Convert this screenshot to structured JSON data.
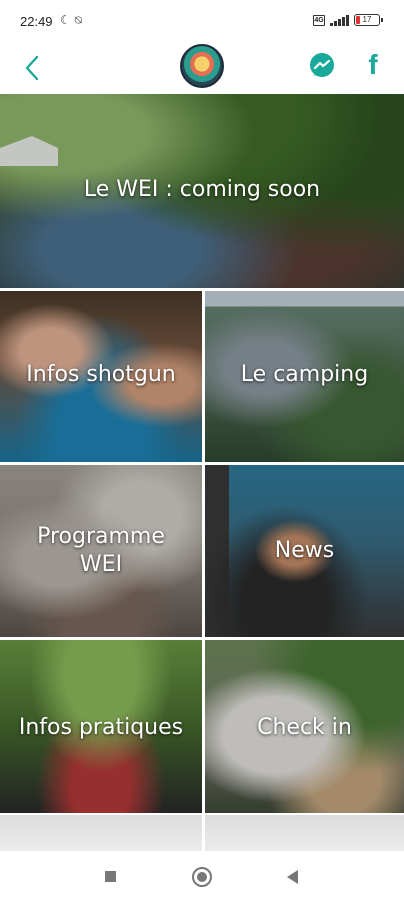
{
  "status_bar": {
    "time": "22:49",
    "left_icons": [
      "moon-icon",
      "mute-icon"
    ],
    "sim_label": "4G",
    "battery_level": "17"
  },
  "header": {
    "back_icon": "chevron-left-icon",
    "logo": "wei-logo",
    "messenger_icon": "messenger-icon",
    "facebook_icon": "facebook-icon",
    "facebook_glyph": "f",
    "accent_color": "#19a99a"
  },
  "hero": {
    "title": "Le WEI : coming soon"
  },
  "tiles": [
    {
      "label": "Infos shotgun"
    },
    {
      "label": "Le camping"
    },
    {
      "label": "Programme WEI"
    },
    {
      "label": "News"
    },
    {
      "label": "Infos pratiques"
    },
    {
      "label": "Check in"
    }
  ],
  "nav_bar": {
    "buttons": [
      "recents-square-icon",
      "home-circle-icon",
      "back-triangle-icon"
    ]
  }
}
